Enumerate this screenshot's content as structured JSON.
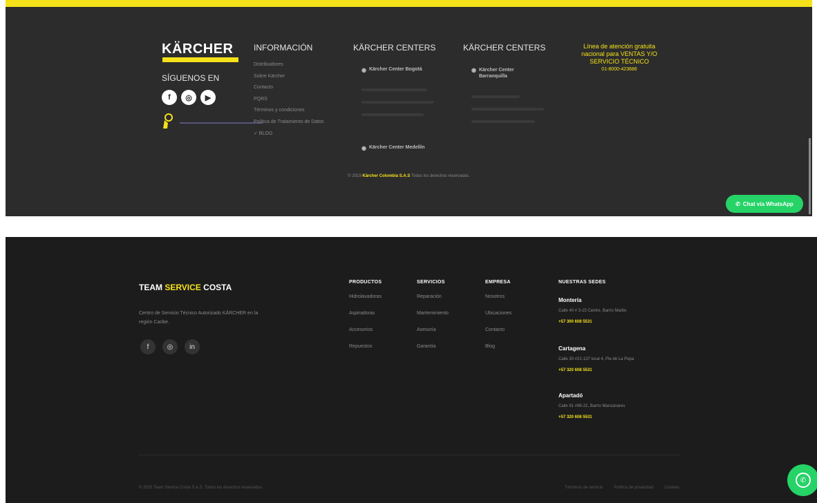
{
  "karcher_footer": {
    "logo_text": "KÄRCHER",
    "follow_label": "SÍGUENOS EN",
    "social_icons": [
      "facebook-icon",
      "instagram-icon",
      "youtube-icon"
    ],
    "info_title": "INFORMACIÓN",
    "info_links": [
      "Distribuidores",
      "Sobre Kärcher",
      "Contacto",
      "PQRS",
      "Términos y condiciones",
      "Política de Tratamiento de Datos",
      "✓ BLOG"
    ],
    "centers_title_1": "KÄRCHER CENTERS",
    "centers_title_2": "KÄRCHER CENTERS",
    "center_bogota": "Kärcher Center Bogotá",
    "center_barranquilla": "Kärcher Center Barranquilla",
    "center_medellin": "Kärcher Center Medellín",
    "hotline": "Línea de atención gratuita nacional para VENTAS Y/O SERVICIO TÉCNICO",
    "hotline_number": "01-8000-423686",
    "copyright_prefix": "© 2019",
    "copyright_company": "Kärcher Colombia S.A.S",
    "copyright_suffix": "Todos los derechos reservados.",
    "whatsapp_label": "Chat vía WhatsApp",
    "accent_color": "#f5e11a"
  },
  "team_footer": {
    "brand_part1": "TEAM",
    "brand_part2": "SERVICE",
    "brand_part3": "COSTA",
    "description": "Centro de Servicio Técnico Autorizado KÄRCHER en la región Caribe.",
    "social_icons": [
      "facebook-icon",
      "instagram-icon",
      "linkedin-icon"
    ],
    "columns": [
      {
        "title": "PRODUCTOS",
        "items": [
          "Hidrolavadoras",
          "Aspiradoras",
          "Accesorios",
          "Repuestos"
        ]
      },
      {
        "title": "SERVICIOS",
        "items": [
          "Reparación",
          "Mantenimiento",
          "Asesoría",
          "Garantía"
        ]
      },
      {
        "title": "EMPRESA",
        "items": [
          "Nosotros",
          "Ubicaciones",
          "Contacto",
          "Blog"
        ]
      }
    ],
    "sedes_title": "NUESTRAS SEDES",
    "sedes": [
      {
        "city": "Montería",
        "address": "Calle 40 # 3-15 Centro, Barrio Marbo",
        "phone": "+57 300 608 5531"
      },
      {
        "city": "Cartagena",
        "address": "Calle 30 #21-137 local 4, Pie de La Popa",
        "phone": "+57 320 608 5531"
      },
      {
        "city": "Apartadó",
        "address": "Calle 91 #96-22, Barrio Manzanares",
        "phone": "+57 320 608 5531"
      }
    ],
    "copyright": "© 2025 Team Service Costa S.A.S. Todos los derechos reservados.",
    "legal_links": [
      "Términos de servicio",
      "Política de privacidad",
      "Cookies"
    ],
    "accent_color": "#f5e11a"
  }
}
